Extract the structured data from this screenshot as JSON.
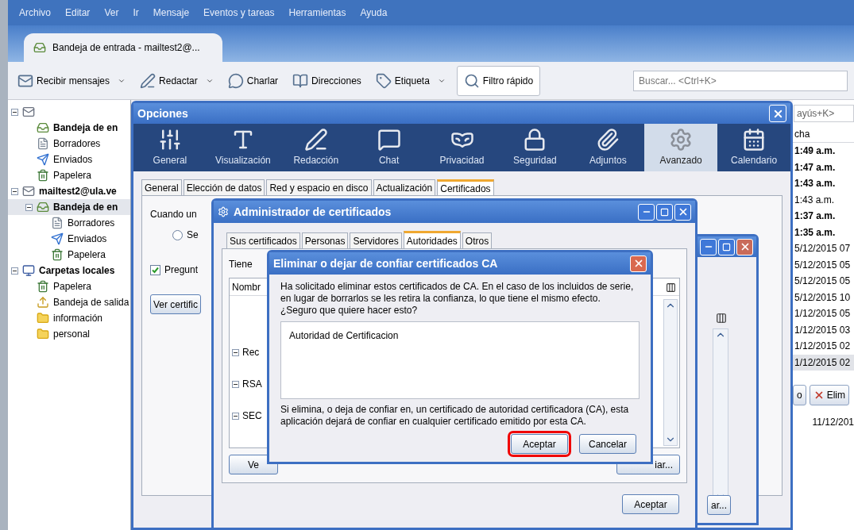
{
  "menu": [
    "Archivo",
    "Editar",
    "Ver",
    "Ir",
    "Mensaje",
    "Eventos y tareas",
    "Herramientas",
    "Ayuda"
  ],
  "tab": {
    "title": "Bandeja de entrada - mailtest2@..."
  },
  "toolbar": [
    {
      "label": "Recibir mensajes",
      "kind": "dropdown"
    },
    {
      "label": "Redactar",
      "kind": "dropdown"
    },
    {
      "label": "Charlar",
      "kind": "plain"
    },
    {
      "label": "Direcciones",
      "kind": "plain"
    },
    {
      "label": "Etiqueta",
      "kind": "dropdown"
    },
    {
      "label": "Filtro rápido",
      "kind": "toggle"
    }
  ],
  "search": {
    "placeholder": "Buscar... <Ctrl+K>"
  },
  "folders": [
    {
      "kind": "account",
      "expanded": true,
      "selected": false,
      "children": [
        {
          "kind": "inbox",
          "label": "Bandeja de en",
          "unread": true,
          "selected": false
        },
        {
          "kind": "drafts",
          "label": "Borradores",
          "unread": false,
          "selected": false
        },
        {
          "kind": "sent",
          "label": "Enviados",
          "unread": false,
          "selected": false
        },
        {
          "kind": "trash",
          "label": "Papelera",
          "unread": false,
          "selected": false
        }
      ]
    },
    {
      "kind": "account",
      "label": "mailtest2@ula.ve",
      "expanded": true,
      "unread": true,
      "selected": false,
      "children": [
        {
          "kind": "inbox",
          "label": "Bandeja de en",
          "unread": true,
          "selected": true,
          "expanded": true,
          "children": [
            {
              "kind": "drafts",
              "label": "Borradores",
              "unread": false,
              "selected": false
            },
            {
              "kind": "sent",
              "label": "Enviados",
              "unread": false,
              "selected": false
            },
            {
              "kind": "trash",
              "label": "Papelera",
              "unread": false,
              "selected": false
            }
          ]
        }
      ]
    },
    {
      "kind": "local",
      "label": "Carpetas locales",
      "expanded": true,
      "unread": true,
      "selected": false,
      "children": [
        {
          "kind": "trash",
          "label": "Papelera",
          "unread": false,
          "selected": false
        },
        {
          "kind": "outbox",
          "label": "Bandeja de salida",
          "unread": false,
          "selected": false
        },
        {
          "kind": "folder",
          "label": "información",
          "unread": false,
          "selected": false
        },
        {
          "kind": "folder",
          "label": "personal",
          "unread": false,
          "selected": false
        }
      ]
    }
  ],
  "message_list": {
    "search_placeholder": "ayús+K>",
    "column": "cha",
    "rows": [
      {
        "text": "1:49 a.m.",
        "unread": true,
        "selected": false
      },
      {
        "text": "1:47 a.m.",
        "unread": true,
        "selected": false
      },
      {
        "text": "1:43 a.m.",
        "unread": true,
        "selected": false
      },
      {
        "text": "1:43 a.m.",
        "unread": false,
        "selected": false
      },
      {
        "text": "1:37 a.m.",
        "unread": true,
        "selected": false
      },
      {
        "text": "1:35 a.m.",
        "unread": true,
        "selected": false
      },
      {
        "text": "5/12/2015 07",
        "unread": false,
        "selected": false
      },
      {
        "text": "5/12/2015 05",
        "unread": false,
        "selected": false
      },
      {
        "text": "5/12/2015 05",
        "unread": false,
        "selected": false
      },
      {
        "text": "5/12/2015 10",
        "unread": false,
        "selected": false
      },
      {
        "text": "1/12/2015 05",
        "unread": false,
        "selected": false
      },
      {
        "text": "1/12/2015 03",
        "unread": false,
        "selected": false
      },
      {
        "text": "1/12/2015 02",
        "unread": false,
        "selected": false
      },
      {
        "text": "1/12/2015 02",
        "unread": false,
        "selected": true
      }
    ],
    "buttons": [
      {
        "label": "o",
        "kind": "plain"
      },
      {
        "label": "Elim",
        "kind": "delete"
      }
    ],
    "date": "11/12/201"
  },
  "options": {
    "title": "Opciones",
    "categories": [
      {
        "label": "General",
        "selected": false
      },
      {
        "label": "Visualización",
        "selected": false
      },
      {
        "label": "Redacción",
        "selected": false
      },
      {
        "label": "Chat",
        "selected": false
      },
      {
        "label": "Privacidad",
        "selected": false
      },
      {
        "label": "Seguridad",
        "selected": false
      },
      {
        "label": "Adjuntos",
        "selected": false
      },
      {
        "label": "Avanzado",
        "selected": true
      },
      {
        "label": "Calendario",
        "selected": false
      }
    ],
    "tabs": [
      {
        "label": "General",
        "selected": false
      },
      {
        "label": "Elección de datos",
        "selected": false
      },
      {
        "label": "Red y espacio en disco",
        "selected": false
      },
      {
        "label": "Actualización",
        "selected": false
      },
      {
        "label": "Certificados",
        "selected": true
      }
    ],
    "prompt": "Cuando un",
    "radio": {
      "label": "Se",
      "selected": false
    },
    "checkbox": {
      "label": "Pregunt",
      "checked": true
    },
    "button": "Ver certific"
  },
  "cert_manager": {
    "title": "Administrador de certificados",
    "tabs": [
      {
        "label": "Sus certificados",
        "selected": false
      },
      {
        "label": "Personas",
        "selected": false
      },
      {
        "label": "Servidores",
        "selected": false
      },
      {
        "label": "Autoridades",
        "selected": true
      },
      {
        "label": "Otros",
        "selected": false
      }
    ],
    "intro": "Tiene",
    "column": "Nombr",
    "rows": [
      {
        "label": "Rec",
        "expanded": true
      },
      {
        "label": "RSA",
        "expanded": true
      },
      {
        "label": "SEC",
        "expanded": true
      }
    ],
    "buttons": [
      "Ve",
      "iar..."
    ],
    "ok": "Aceptar"
  },
  "back_window": {
    "button": "ar..."
  },
  "confirm": {
    "title": "Eliminar o dejar de confiar certificados CA",
    "message": "Ha solicitado eliminar estos certificados de CA. En el caso de los incluidos de serie, en lugar de borrarlos se les retira la confianza, lo que tiene el mismo efecto. ¿Seguro que quiere hacer esto?",
    "items": [
      "Autoridad de Certificacion"
    ],
    "note": "Si elimina, o deja de confiar en, un certificado de autoridad certificadora (CA), esta aplicación dejará de confiar en cualquier certificado emitido por esta CA.",
    "buttons": [
      {
        "label": "Aceptar",
        "highlighted": true
      },
      {
        "label": "Cancelar",
        "highlighted": false
      }
    ]
  }
}
